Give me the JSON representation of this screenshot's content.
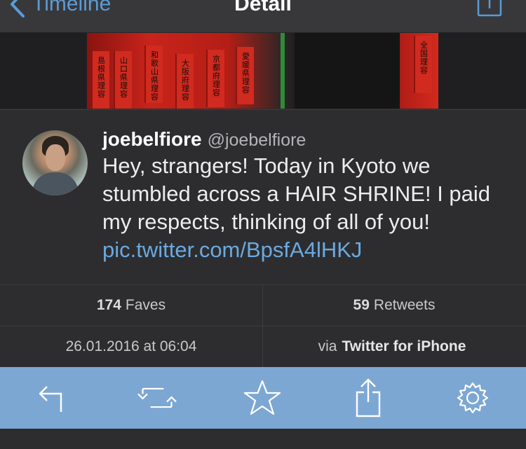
{
  "navbar": {
    "back_label": "Timeline",
    "title": "Detail"
  },
  "hero_image": {
    "plank_texts": [
      "島根県理容",
      "山口県理容",
      "和歌山県理容",
      "大阪府理容",
      "京都府理容",
      "愛媛県理容"
    ],
    "right_plank_text": "全国理容"
  },
  "tweet": {
    "display_name": "joebelfiore",
    "handle": "@joebelfiore",
    "text": "Hey, strangers! Today in Kyoto we stumbled across a HAIR SHRINE! I paid my respects, thinking of all of you! ",
    "link": "pic.twitter.com/BpsfA4lHKJ"
  },
  "stats": {
    "faves_count": "174",
    "faves_label": "Faves",
    "retweets_count": "59",
    "retweets_label": "Retweets",
    "timestamp": "26.01.2016 at 06:04",
    "via_prefix": "via",
    "client": "Twitter for iPhone"
  },
  "toolbar": {
    "icons": [
      "reply-icon",
      "retweet-icon",
      "favorite-star-icon",
      "share-icon",
      "settings-gear-icon"
    ]
  },
  "colors": {
    "accent": "#5b9bd5",
    "link": "#6aa9e0",
    "toolbar_bg": "#7da7d3",
    "background": "#2d2d2f"
  }
}
